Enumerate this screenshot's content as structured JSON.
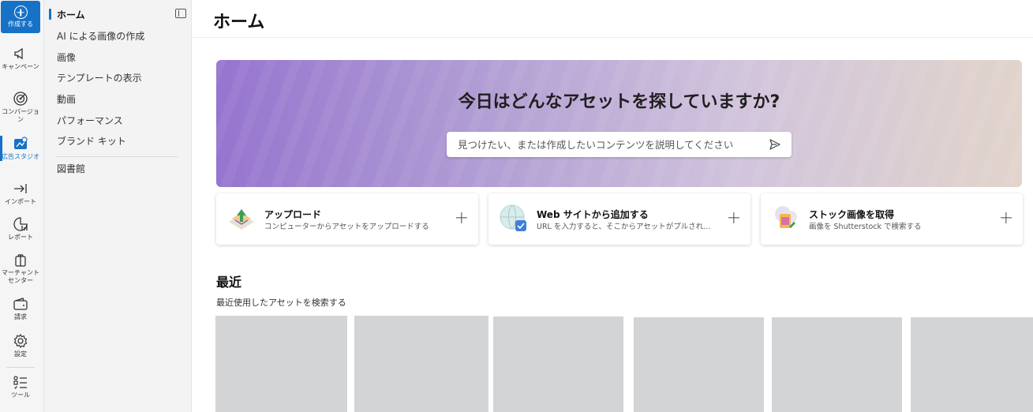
{
  "rail": {
    "create_label": "作成する",
    "items": [
      {
        "label": "キャンペーン",
        "icon": "megaphone-icon"
      },
      {
        "label": "コンバージョン",
        "icon": "target-icon"
      },
      {
        "label": "広告スタジオ",
        "icon": "ad-studio-icon",
        "active": true
      },
      {
        "label": "インポート",
        "icon": "import-icon"
      },
      {
        "label": "レポート",
        "icon": "report-icon"
      },
      {
        "label": "マーチャント センター",
        "icon": "gift-icon"
      },
      {
        "label": "請求",
        "icon": "wallet-icon"
      },
      {
        "label": "設定",
        "icon": "gear-icon"
      },
      {
        "label": "ツール",
        "icon": "tools-list-icon"
      }
    ]
  },
  "subnav": {
    "items": [
      {
        "label": "ホーム",
        "active": true
      },
      {
        "label": "AI による画像の作成"
      },
      {
        "label": "画像"
      },
      {
        "label": "テンプレートの表示"
      },
      {
        "label": "動画"
      },
      {
        "label": "パフォーマンス"
      },
      {
        "label": "ブランド キット"
      },
      {
        "label": "図書館"
      }
    ]
  },
  "main": {
    "title": "ホーム",
    "hero": {
      "title": "今日はどんなアセットを探していますか?",
      "search_placeholder": "見つけたい、または作成したいコンテンツを説明してください"
    },
    "cards": [
      {
        "title": "アップロード",
        "subtitle": "コンピューターからアセットをアップロードする"
      },
      {
        "title": "Web サイトから追加する",
        "subtitle": "URL を入力すると、そこからアセットがプルされ..."
      },
      {
        "title": "ストック画像を取得",
        "subtitle": "画像を Shutterstock で検索する"
      }
    ],
    "recent": {
      "title": "最近",
      "subtitle": "最近使用したアセットを検索する"
    }
  },
  "colors": {
    "accent": "#1672c6",
    "tile_placeholder": "#d3d4d6"
  }
}
